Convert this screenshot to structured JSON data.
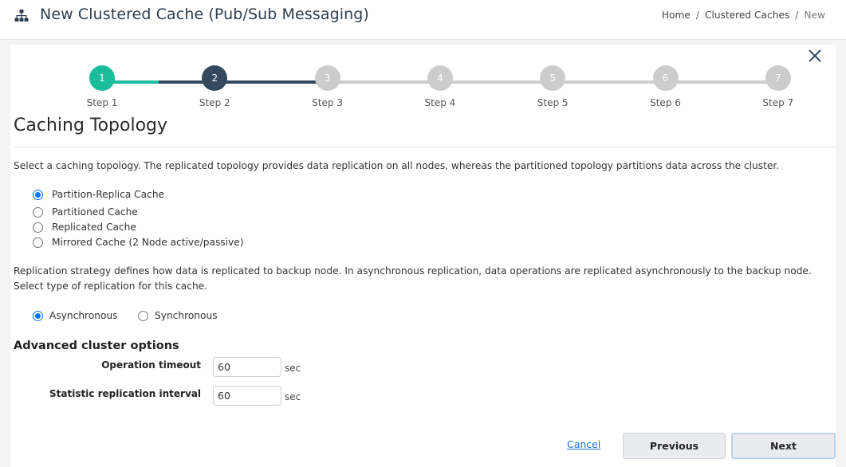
{
  "header": {
    "title": "New Clustered Cache (Pub/Sub Messaging)",
    "title_icon": "sitemap-icon",
    "breadcrumb": [
      "Home",
      "Clustered Caches",
      "New"
    ],
    "breadcrumb_separator": "/"
  },
  "colors": {
    "step_completed": "#1abc9c",
    "step_active": "#34495e",
    "step_pending": "#cccccc",
    "radio_checked": "#0075ff",
    "link": "#1a6fd0"
  },
  "wizard": {
    "close_icon": "close-icon",
    "current_step": 2,
    "steps": [
      {
        "number": "1",
        "label": "Step 1",
        "state": "completed"
      },
      {
        "number": "2",
        "label": "Step 2",
        "state": "active"
      },
      {
        "number": "3",
        "label": "Step 3",
        "state": "pending"
      },
      {
        "number": "4",
        "label": "Step 4",
        "state": "pending"
      },
      {
        "number": "5",
        "label": "Step 5",
        "state": "pending"
      },
      {
        "number": "6",
        "label": "Step 6",
        "state": "pending"
      },
      {
        "number": "7",
        "label": "Step 7",
        "state": "pending"
      }
    ]
  },
  "topology": {
    "title": "Caching Topology",
    "description": "Select a caching topology. The replicated topology provides data replication on all nodes, whereas the partitioned topology partitions data across the cluster.",
    "options": [
      {
        "label": "Partition-Replica Cache",
        "checked": true
      },
      {
        "label": "Partitioned Cache",
        "checked": false
      },
      {
        "label": "Replicated Cache",
        "checked": false
      },
      {
        "label": "Mirrored Cache (2 Node active/passive)",
        "checked": false
      }
    ]
  },
  "replication": {
    "description": "Replication strategy defines how data is replicated to backup node. In asynchronous replication, data operations are replicated asynchronously to the backup node. Select type of replication for this cache.",
    "options": [
      {
        "label": "Asynchronous",
        "checked": true
      },
      {
        "label": "Synchronous",
        "checked": false
      }
    ]
  },
  "advanced": {
    "title": "Advanced cluster options",
    "fields": [
      {
        "label": "Operation timeout",
        "value": "60",
        "unit": "sec"
      },
      {
        "label": "Statistic replication interval",
        "value": "60",
        "unit": "sec"
      }
    ]
  },
  "footer": {
    "cancel_label": "Cancel",
    "previous_label": "Previous",
    "next_label": "Next"
  }
}
